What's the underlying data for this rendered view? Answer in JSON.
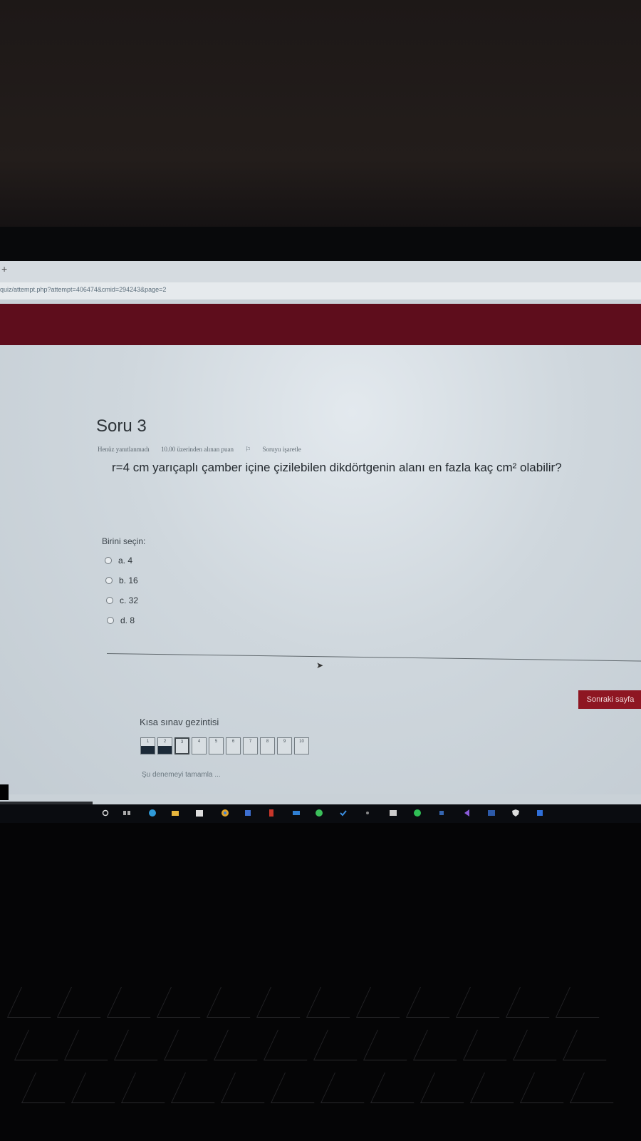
{
  "browser": {
    "new_tab": "+",
    "url": "quiz/attempt.php?attempt=406474&cmid=294243&page=2"
  },
  "question": {
    "title": "Soru 3",
    "status": "Henüz yanıtlanmadı",
    "points": "10.00 üzerinden alınan puan",
    "flag": "Soruyu işaretle",
    "text": "r=4 cm yarıçaplı çamber içine çizilebilen dikdörtgenin alanı en fazla kaç cm² olabilir?",
    "prompt": "Birini seçin:",
    "options": [
      {
        "label": "a. 4"
      },
      {
        "label": "b. 16"
      },
      {
        "label": "c. 32"
      },
      {
        "label": "d. 8"
      }
    ]
  },
  "next_button": "Sonraki sayfa",
  "quiz_nav": {
    "title": "Kısa sınav gezintisi",
    "items": [
      {
        "label": "1",
        "state": "answered"
      },
      {
        "label": "2",
        "state": "answered"
      },
      {
        "label": "3",
        "state": "current"
      },
      {
        "label": "4",
        "state": "empty"
      },
      {
        "label": "5",
        "state": "empty"
      },
      {
        "label": "6",
        "state": "empty"
      },
      {
        "label": "7",
        "state": "empty"
      },
      {
        "label": "8",
        "state": "empty"
      },
      {
        "label": "9",
        "state": "empty"
      },
      {
        "label": "10",
        "state": "empty"
      }
    ],
    "finish_link": "Şu denemeyi tamamla ..."
  },
  "taskbar": {
    "icons": [
      "search-icon",
      "task-view-icon",
      "edge-icon",
      "folder-icon",
      "store-icon",
      "chrome-icon",
      "app-icon",
      "office-icon",
      "mail-icon",
      "whatsapp-icon",
      "check-icon",
      "app-icon",
      "photos-icon",
      "spotify-icon",
      "app-icon",
      "vscode-icon",
      "app-icon",
      "shield-icon",
      "app-icon"
    ]
  },
  "colors": {
    "brand": "#5e0d1c",
    "button": "#8e1622",
    "answered": "#1c2a38"
  }
}
